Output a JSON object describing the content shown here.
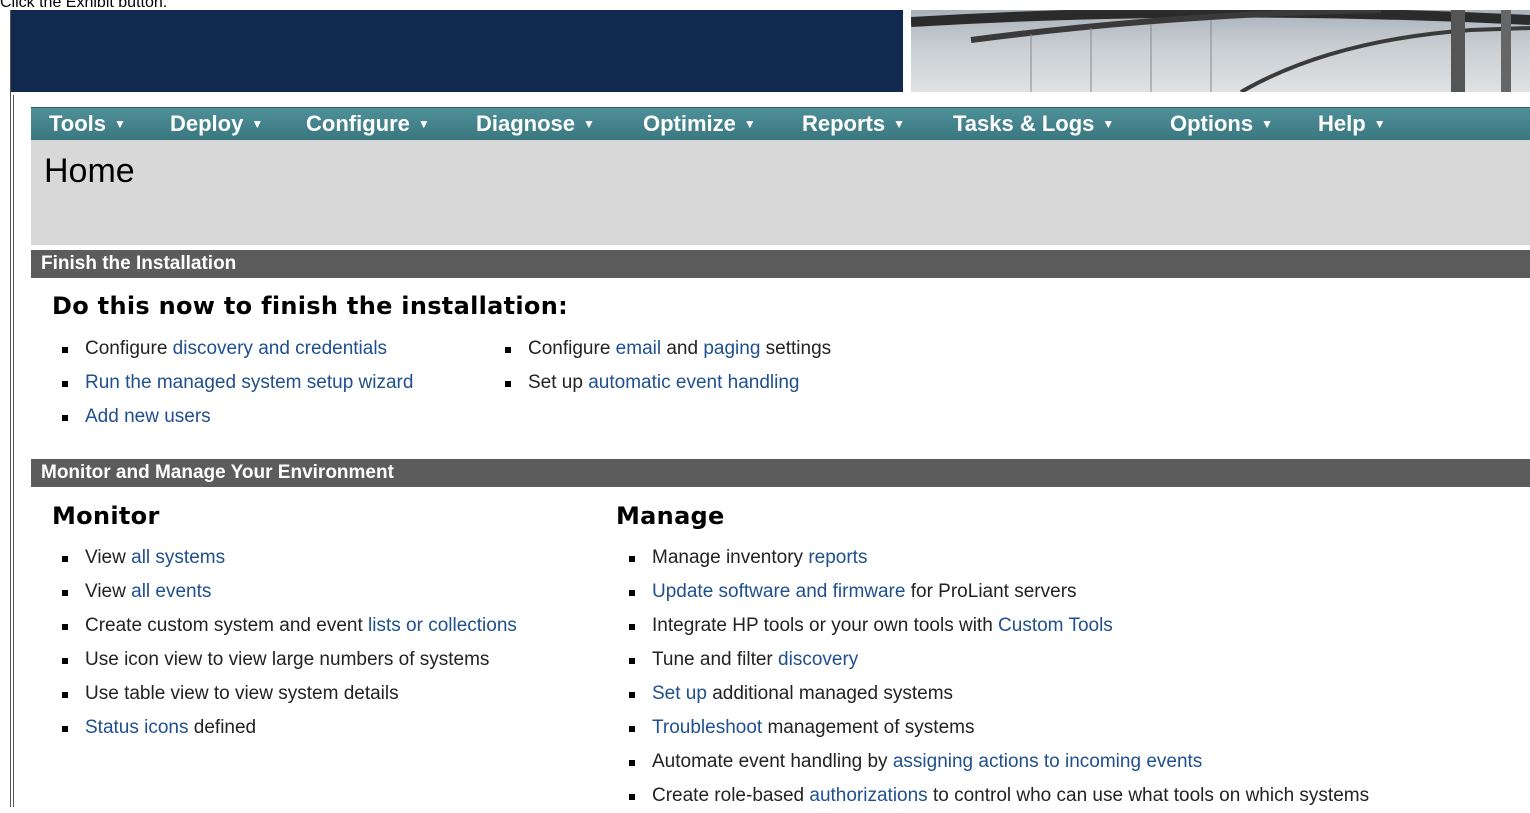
{
  "instruction": "Click the Exhibit button.",
  "menu": [
    {
      "label": "Tools"
    },
    {
      "label": "Deploy"
    },
    {
      "label": "Configure"
    },
    {
      "label": "Diagnose"
    },
    {
      "label": "Optimize"
    },
    {
      "label": "Reports"
    },
    {
      "label": "Tasks & Logs"
    },
    {
      "label": "Options"
    },
    {
      "label": "Help"
    }
  ],
  "caret_glyph": "▼",
  "page_title": "Home",
  "finish": {
    "bar_title": "Finish the Installation",
    "heading": "Do this now to finish the installation:",
    "col1": [
      {
        "pre": "Configure ",
        "link": "discovery and credentials",
        "post": ""
      },
      {
        "pre": "",
        "link": "Run the managed system setup wizard",
        "post": ""
      },
      {
        "pre": "",
        "link": "Add new users",
        "post": ""
      }
    ],
    "col2": [
      {
        "pre": "Configure ",
        "link": "email",
        "mid": " and ",
        "link2": "paging",
        "post": " settings"
      },
      {
        "pre": "Set up ",
        "link": "automatic event handling",
        "post": ""
      }
    ]
  },
  "monitor_manage": {
    "bar_title": "Monitor and Manage Your Environment",
    "monitor": {
      "heading": "Monitor",
      "items": [
        {
          "pre": "View ",
          "link": "all systems",
          "post": ""
        },
        {
          "pre": "View ",
          "link": "all events",
          "post": ""
        },
        {
          "pre": "Create custom system and event ",
          "link": "lists or collections",
          "post": ""
        },
        {
          "pre": "Use icon view to view large numbers of systems",
          "link": "",
          "post": ""
        },
        {
          "pre": "Use table view to view system details",
          "link": "",
          "post": ""
        },
        {
          "pre": "",
          "link": "Status icons",
          "post": " defined"
        }
      ]
    },
    "manage": {
      "heading": "Manage",
      "items": [
        {
          "pre": "Manage inventory ",
          "link": "reports",
          "post": ""
        },
        {
          "pre": "",
          "link": "Update software and firmware",
          "post": " for ProLiant servers"
        },
        {
          "pre": "Integrate HP tools or your own tools with ",
          "link": "Custom Tools",
          "post": ""
        },
        {
          "pre": "Tune and filter ",
          "link": "discovery",
          "post": ""
        },
        {
          "pre": "",
          "link": "Set up",
          "post": " additional managed systems"
        },
        {
          "pre": "",
          "link": "Troubleshoot",
          "post": " management of systems"
        },
        {
          "pre": "Automate event handling by ",
          "link": "assigning actions to incoming events",
          "post": ""
        },
        {
          "pre": "Create role-based ",
          "link": "authorizations",
          "post": " to control who can use what tools on which systems"
        }
      ]
    }
  },
  "colors": {
    "banner": "#11294f",
    "menubar": "#3f7f87",
    "pagehead": "#d8d8d8",
    "section_bar": "#5c5c5c",
    "link": "#1f4f8f"
  }
}
